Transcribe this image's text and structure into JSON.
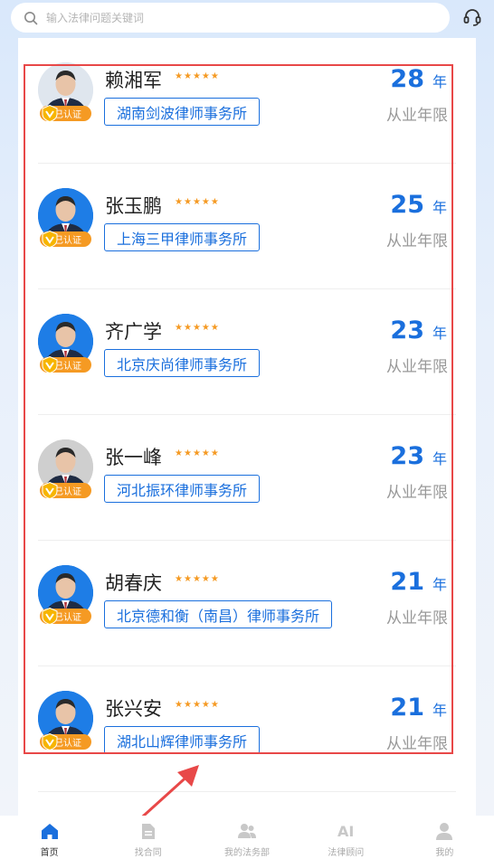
{
  "search": {
    "placeholder": "输入法律问题关键词"
  },
  "accent": "#1a6fdd",
  "badge_color": "#f59a23",
  "lawyers": [
    {
      "name": "赖湘军",
      "rating": 5,
      "verified": "已认证",
      "firm": "湖南剑波律师事务所",
      "years": "28",
      "unit": "年",
      "years_label": "从业年限"
    },
    {
      "name": "张玉鹏",
      "rating": 5,
      "verified": "已认证",
      "firm": "上海三甲律师事务所",
      "years": "25",
      "unit": "年",
      "years_label": "从业年限"
    },
    {
      "name": "齐广学",
      "rating": 5,
      "verified": "已认证",
      "firm": "北京庆尚律师事务所",
      "years": "23",
      "unit": "年",
      "years_label": "从业年限"
    },
    {
      "name": "张一峰",
      "rating": 5,
      "verified": "已认证",
      "firm": "河北振环律师事务所",
      "years": "23",
      "unit": "年",
      "years_label": "从业年限"
    },
    {
      "name": "胡春庆",
      "rating": 5,
      "verified": "已认证",
      "firm": "北京德和衡（南昌）律师事务所",
      "years": "21",
      "unit": "年",
      "years_label": "从业年限"
    },
    {
      "name": "张兴安",
      "rating": 5,
      "verified": "已认证",
      "firm": "湖北山辉律师事务所",
      "years": "21",
      "unit": "年",
      "years_label": "从业年限"
    }
  ],
  "tabs": [
    {
      "label": "首页",
      "icon": "home-icon",
      "active": true
    },
    {
      "label": "找合同",
      "icon": "document-icon",
      "active": false
    },
    {
      "label": "我的法务部",
      "icon": "team-icon",
      "active": false
    },
    {
      "label": "法律顾问",
      "icon": "ai-icon",
      "active": false
    },
    {
      "label": "我的",
      "icon": "user-icon",
      "active": false
    }
  ]
}
